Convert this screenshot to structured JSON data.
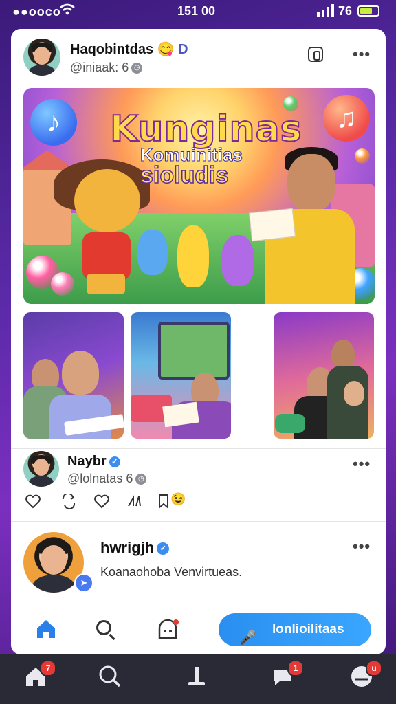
{
  "status_bar": {
    "signal": "●●ooco",
    "time": "151 00",
    "battery_level": "76",
    "battery_percent": 0.7,
    "battery_color": "#c8ef3a"
  },
  "post1": {
    "author_name": "Haqobintdas",
    "author_emoji": "😋",
    "author_badge": "D",
    "handle": "@iniaak: 6",
    "more_label": "•••",
    "hero": {
      "title_line1": "Kunginas",
      "title_line2": "Komuinitias",
      "title_line3": "sioludis"
    }
  },
  "post2": {
    "author_name": "Naybr",
    "handle": "@lolnatas 6",
    "more_label": "•••",
    "actions": [
      "heart-icon",
      "repost-icon",
      "like-icon",
      "share-icon",
      "bookmark-icon"
    ],
    "action_emoji": "😉"
  },
  "post3": {
    "author_name": "hwrigjh",
    "body_text": "Koanaohoba Venvirtueas.",
    "more_label": "•••"
  },
  "card_footer": {
    "cta_label": "lonlioilitaas",
    "cta_color": "#2a8ff0"
  },
  "tab_bar": {
    "home_badge": "7",
    "messages_badge": "1",
    "profile_badge": "u"
  },
  "colors": {
    "accent": "#3b8df0",
    "badge": "#e53935",
    "tab_bar_bg": "#2a2a36"
  }
}
